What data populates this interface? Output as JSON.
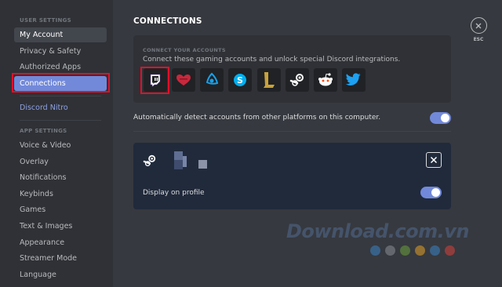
{
  "sidebar": {
    "user_settings_header": "USER SETTINGS",
    "items": [
      {
        "label": "My Account"
      },
      {
        "label": "Privacy & Safety"
      },
      {
        "label": "Authorized Apps"
      },
      {
        "label": "Connections"
      }
    ],
    "nitro_label": "Discord Nitro",
    "app_settings_header": "APP SETTINGS",
    "app_items": [
      {
        "label": "Voice & Video"
      },
      {
        "label": "Overlay"
      },
      {
        "label": "Notifications"
      },
      {
        "label": "Keybinds"
      },
      {
        "label": "Games"
      },
      {
        "label": "Text & Images"
      },
      {
        "label": "Appearance"
      },
      {
        "label": "Streamer Mode"
      },
      {
        "label": "Language"
      }
    ]
  },
  "main": {
    "title": "CONNECTIONS",
    "connect_header": "CONNECT YOUR ACCOUNTS",
    "connect_description": "Connect these gaming accounts and unlock special Discord integrations.",
    "accounts": [
      "twitch-icon",
      "battlenet-heart-icon",
      "battlenet-icon",
      "skype-icon",
      "league-of-legends-icon",
      "steam-icon",
      "reddit-icon",
      "twitter-icon"
    ],
    "auto_detect_label": "Automatically detect accounts from other platforms on this computer.",
    "auto_detect_enabled": true,
    "connected_account": {
      "platform_icon": "steam-icon",
      "display_on_profile_label": "Display on profile",
      "display_on_profile_enabled": true
    },
    "esc_label": "ESC"
  },
  "watermark": {
    "text": "Download.com.vn",
    "dot_colors": [
      "#3b83c4",
      "#8b8f96",
      "#6aa03a",
      "#e3a227",
      "#3b83c4",
      "#d9413a"
    ]
  },
  "colors": {
    "accent": "#7289da",
    "highlight_red": "#e0102a"
  }
}
